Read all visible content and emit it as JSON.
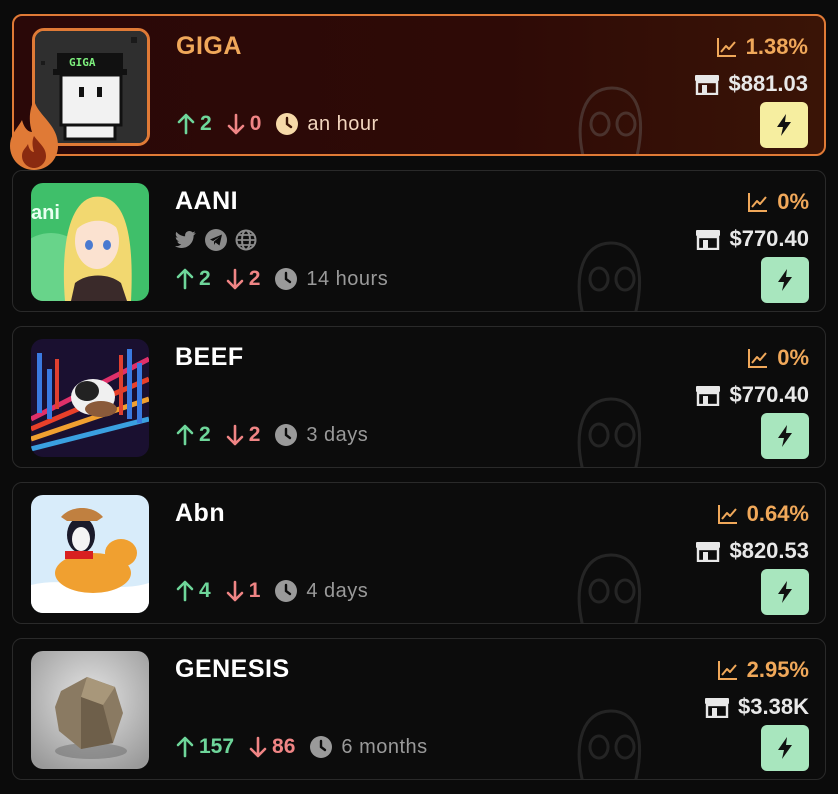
{
  "tokens": [
    {
      "name": "GIGA",
      "up": "2",
      "down": "0",
      "time": "an hour",
      "change": "1.38%",
      "market_cap": "$881.03",
      "featured": true,
      "has_socials": false
    },
    {
      "name": "AANI",
      "up": "2",
      "down": "2",
      "time": "14 hours",
      "change": "0%",
      "market_cap": "$770.40",
      "featured": false,
      "has_socials": true
    },
    {
      "name": "BEEF",
      "up": "2",
      "down": "2",
      "time": "3 days",
      "change": "0%",
      "market_cap": "$770.40",
      "featured": false,
      "has_socials": false
    },
    {
      "name": "Abn",
      "up": "4",
      "down": "1",
      "time": "4 days",
      "change": "0.64%",
      "market_cap": "$820.53",
      "featured": false,
      "has_socials": false
    },
    {
      "name": "GENESIS",
      "up": "157",
      "down": "86",
      "time": "6 months",
      "change": "2.95%",
      "market_cap": "$3.38K",
      "featured": false,
      "has_socials": false
    }
  ],
  "thumb_text": {
    "giga_cap": "GIGA",
    "aani_overlay": "ani"
  },
  "colors": {
    "accent": "#e07a36",
    "up": "#6ed69a",
    "down": "#f08585",
    "change": "#f0a85a",
    "bolt_green": "#a8e6be",
    "bolt_yellow": "#f6eea0"
  },
  "icons": {
    "up": "arrow-up-icon",
    "down": "arrow-down-icon",
    "time": "clock-icon",
    "change": "chart-line-icon",
    "market": "store-icon",
    "buy": "lightning-icon",
    "socials": [
      "twitter-icon",
      "telegram-icon",
      "globe-icon"
    ],
    "hot": "fire-icon"
  }
}
